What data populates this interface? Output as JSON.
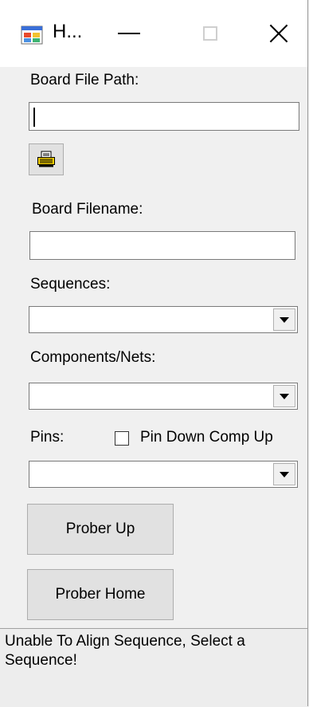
{
  "window": {
    "title": "H...",
    "icon": "app-form-icon"
  },
  "titlebar_buttons": {
    "minimize_icon": "minimize-icon",
    "maximize_icon": "maximize-icon",
    "close_icon": "close-icon"
  },
  "form": {
    "board_file_path_label": "Board File Path:",
    "board_file_path_value": "",
    "browse_icon": "printer-icon",
    "board_filename_label": "Board Filename:",
    "board_filename_value": "",
    "sequences_label": "Sequences:",
    "sequences_value": "",
    "components_label": "Components/Nets:",
    "components_value": "",
    "pins_label": "Pins:",
    "pin_down_checkbox_label": "Pin Down Comp Up",
    "pin_down_checked": false,
    "pins_value": ""
  },
  "buttons": {
    "prober_up": "Prober Up",
    "prober_home": "Prober Home"
  },
  "status": {
    "message": "Unable To Align Sequence, Select a Sequence!"
  }
}
